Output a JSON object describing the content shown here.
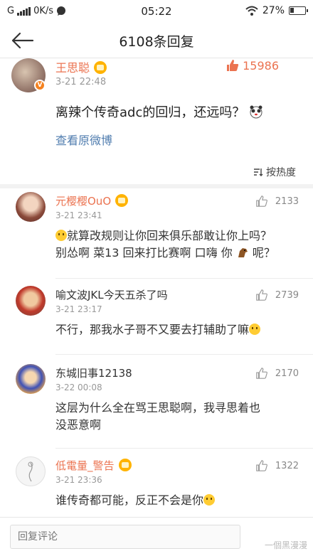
{
  "status_bar": {
    "carrier": "G",
    "speed": "0K/s",
    "time": "05:22",
    "battery": "27%",
    "battery_level": 0.27
  },
  "nav": {
    "title": "6108条回复"
  },
  "post": {
    "username": "王思聪",
    "time": "3-21 22:48",
    "likes": "15986",
    "text": "离辣个传奇adc的回归，还远吗？",
    "view_original": "查看原微博",
    "sort_label": "按热度"
  },
  "comments": [
    {
      "username": "元樱樱OuO",
      "time": "3-21 23:41",
      "likes": "2133",
      "line1": "就算改规则让你回来俱乐部敢让你上吗？",
      "line2a": "别怂啊 菜13 回来打比赛啊 口嗨 你 ",
      "line2b": "呢？"
    },
    {
      "username": "喻文波JKL今天五杀了吗",
      "time": "3-21 23:17",
      "likes": "2739",
      "text": "不行，那我水子哥不又要去打辅助了嘛"
    },
    {
      "username": "东城旧事12138",
      "time": "3-22 00:08",
      "likes": "2170",
      "text": "这层为什么全在骂王思聪啊，我寻思着也没恶意啊"
    },
    {
      "username": "低電量_警告",
      "time": "3-21 23:36",
      "likes": "1322",
      "text": "谁传奇都可能，反正不会是你"
    }
  ],
  "bottom": {
    "placeholder": "回复评论",
    "watermark": "一個黑漫漫"
  },
  "colors": {
    "accent": "#eb7350",
    "link": "#507daf"
  }
}
